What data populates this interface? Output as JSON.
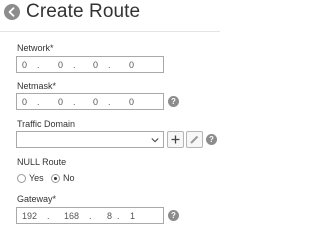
{
  "header": {
    "title": "Create Route",
    "back_icon": "back-arrow-circle-icon"
  },
  "form": {
    "network": {
      "label": "Network*",
      "octets": [
        "0",
        "0",
        "0",
        "0"
      ],
      "separators": [
        ".",
        ".",
        "."
      ]
    },
    "netmask": {
      "label": "Netmask*",
      "octets": [
        "0",
        "0",
        "0",
        "0"
      ],
      "separators": [
        ".",
        ".",
        "."
      ],
      "help": "?"
    },
    "traffic_domain": {
      "label": "Traffic Domain",
      "value": "",
      "add_icon": "plus-icon",
      "edit_icon": "pencil-icon",
      "help": "?"
    },
    "null_route": {
      "label": "NULL Route",
      "options": [
        {
          "label": "Yes",
          "checked": false
        },
        {
          "label": "No",
          "checked": true
        }
      ]
    },
    "gateway": {
      "label": "Gateway*",
      "octets": [
        "192",
        "168",
        "8",
        "1"
      ],
      "separators": [
        ".",
        ".",
        "."
      ],
      "help": "?"
    }
  },
  "colors": {
    "icon_gray": "#8c8c8c",
    "border": "#a9a9a9"
  }
}
